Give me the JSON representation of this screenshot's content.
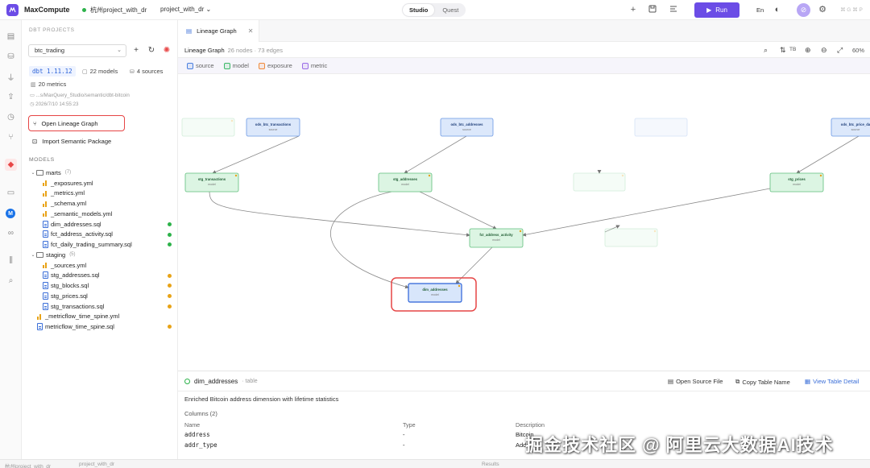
{
  "app": {
    "name": "MaxCompute",
    "project_location": "杭州project_with_dr",
    "project_name": "project_with_dr",
    "modes": [
      "Studio",
      "Quest"
    ],
    "active_mode": "Studio",
    "run_label": "Run",
    "language": "En",
    "shortcut": "⌘ G ⌘ P",
    "brand_color": "#6b4ce6"
  },
  "rail": {
    "icons": [
      "document-icon",
      "database-icon",
      "plug-icon",
      "upload-icon",
      "clock-icon",
      "git-branch-icon",
      "dbt-icon",
      "inbox-icon",
      "maxcompute-icon",
      "link-icon",
      "library-icon",
      "search-icon"
    ],
    "m_label": "M"
  },
  "sidebar": {
    "heading": "DBT PROJECTS",
    "selected_project": "btc_trading",
    "dbt_version": "dbt 1.11.12",
    "models_count": "22 models",
    "sources_count": "4 sources",
    "metrics_count": "20 metrics",
    "path": "...s/MaxQuery_Studio/semantic/dbt-bitcoin",
    "timestamp": "2026/7/10 14:55:23",
    "open_lineage": "Open Lineage Graph",
    "import_semantic": "Import Semantic Package",
    "models_heading": "MODELS",
    "tree": [
      {
        "type": "folder",
        "name": "marts",
        "count": "(7)",
        "level": 0
      },
      {
        "type": "yml",
        "name": "_exposures.yml",
        "level": 1
      },
      {
        "type": "yml",
        "name": "_metrics.yml",
        "level": 1
      },
      {
        "type": "yml",
        "name": "_schema.yml",
        "level": 1
      },
      {
        "type": "yml",
        "name": "_semantic_models.yml",
        "level": 1
      },
      {
        "type": "sql",
        "name": "dim_addresses.sql",
        "level": 1,
        "status": "#2db24a"
      },
      {
        "type": "sql",
        "name": "fct_address_activity.sql",
        "level": 1,
        "status": "#2db24a"
      },
      {
        "type": "sql",
        "name": "fct_daily_trading_summary.sql",
        "level": 1,
        "status": "#2db24a"
      },
      {
        "type": "folder",
        "name": "staging",
        "count": "(5)",
        "level": 0
      },
      {
        "type": "yml",
        "name": "_sources.yml",
        "level": 1
      },
      {
        "type": "sql",
        "name": "stg_addresses.sql",
        "level": 1,
        "status": "#e8a317"
      },
      {
        "type": "sql",
        "name": "stg_blocks.sql",
        "level": 1,
        "status": "#e8a317"
      },
      {
        "type": "sql",
        "name": "stg_prices.sql",
        "level": 1,
        "status": "#e8a317"
      },
      {
        "type": "sql",
        "name": "stg_transactions.sql",
        "level": 1,
        "status": "#e8a317"
      },
      {
        "type": "yml",
        "name": "_metricflow_time_spine.yml",
        "level": 0
      },
      {
        "type": "sql",
        "name": "metricflow_time_spine.sql",
        "level": 0,
        "status": "#e8a317"
      }
    ]
  },
  "tab": {
    "label": "Lineage Graph"
  },
  "graph": {
    "title": "Lineage Graph",
    "stats": "26 nodes · 73 edges",
    "direction": "TB",
    "zoom": "60%",
    "legend": [
      {
        "label": "source",
        "color": "#4a7fe0"
      },
      {
        "label": "model",
        "color": "#3cb868"
      },
      {
        "label": "exposure",
        "color": "#f08a3c"
      },
      {
        "label": "metric",
        "color": "#9b6ee6"
      }
    ],
    "nodes": [
      {
        "id": "n_src_faded1",
        "name": "",
        "kind": "",
        "type": "model",
        "faded": true
      },
      {
        "id": "n_ods_tx",
        "name": "ods_btc_transactions",
        "kind": "source",
        "type": "source"
      },
      {
        "id": "n_ods_addr",
        "name": "ods_btc_addresses",
        "kind": "source",
        "type": "source"
      },
      {
        "id": "n_src_faded2",
        "name": "",
        "kind": "",
        "type": "source",
        "faded": true
      },
      {
        "id": "n_ods_price",
        "name": "ods_btc_price_da",
        "kind": "source",
        "type": "source"
      },
      {
        "id": "n_stg_tx",
        "name": "stg_transactions",
        "kind": "model",
        "type": "model"
      },
      {
        "id": "n_stg_addr",
        "name": "stg_addresses",
        "kind": "model",
        "type": "model"
      },
      {
        "id": "n_stg_faded",
        "name": "",
        "kind": "",
        "type": "model",
        "faded": true
      },
      {
        "id": "n_stg_prices",
        "name": "stg_prices",
        "kind": "model",
        "type": "model"
      },
      {
        "id": "n_fct",
        "name": "fct_address_activity",
        "kind": "model",
        "type": "model"
      },
      {
        "id": "n_fct_faded",
        "name": "",
        "kind": "",
        "type": "model",
        "faded": true
      },
      {
        "id": "n_dim",
        "name": "dim_addresses",
        "kind": "model",
        "type": "model",
        "selected": true
      }
    ]
  },
  "detail": {
    "name": "dim_addresses",
    "kind": "· table",
    "open_source": "Open Source File",
    "copy_table": "Copy Table Name",
    "view_detail": "View Table Detail",
    "description": "Enriched Bitcoin address dimension with lifetime statistics",
    "columns_label": "Columns (2)",
    "headers": [
      "Name",
      "Type",
      "Description"
    ],
    "rows": [
      {
        "name": "address",
        "type": "-",
        "desc": "Bitcoin"
      },
      {
        "name": "addr_type",
        "type": "-",
        "desc": "Addr"
      }
    ]
  },
  "statusbar": {
    "left": "杭州project_with_dr",
    "left2": "project_with_dr",
    "results": "Results"
  },
  "watermark": "掘金技术社区 @ 阿里云大数据AI技术"
}
